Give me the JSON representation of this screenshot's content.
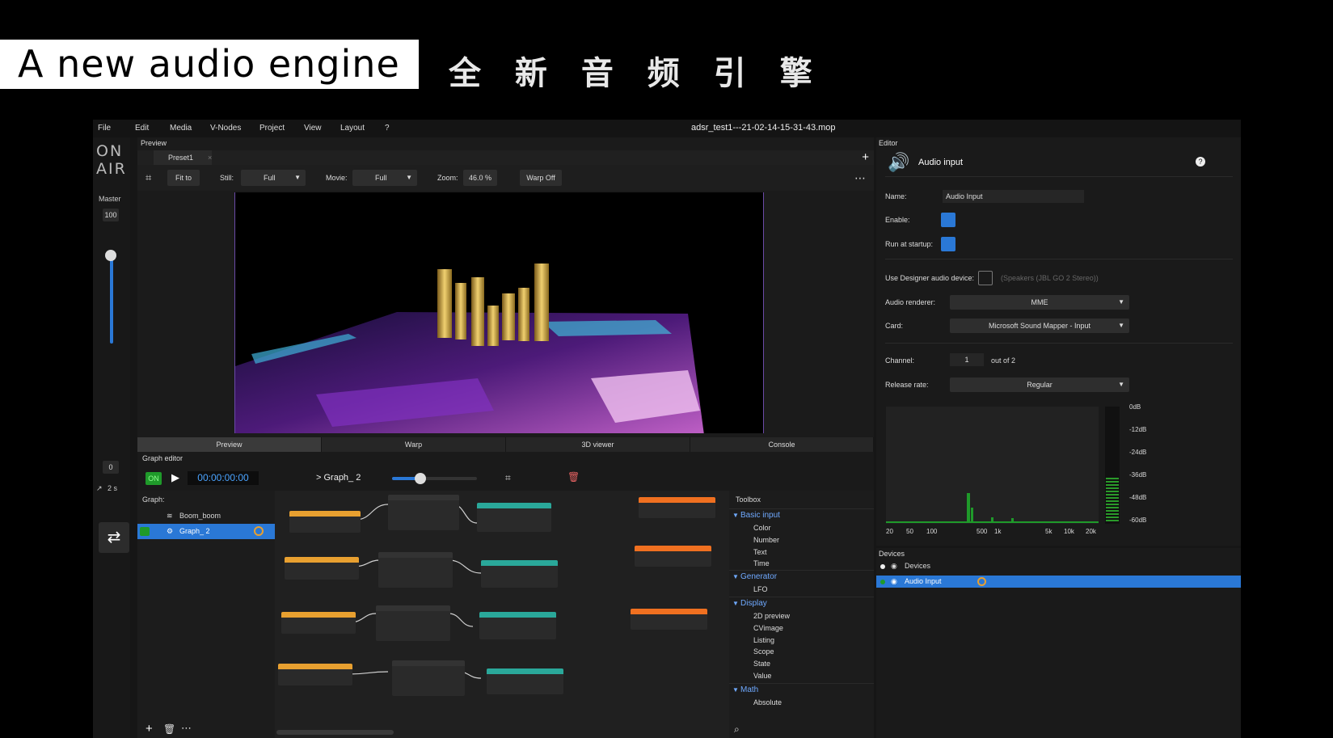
{
  "banner": {
    "title": "A new audio engine",
    "subtitle_cn": "全 新 音 频 引 擎"
  },
  "menubar": {
    "items": [
      "File",
      "Edit",
      "Media",
      "V-Nodes",
      "Project",
      "View",
      "Layout",
      "?"
    ],
    "file_title": "adsr_test1---21-02-14-15-31-43.mop"
  },
  "left_rail": {
    "logo_line1": "ON",
    "logo_line2": "AIR",
    "master_label": "Master",
    "master_value": "100",
    "zero_value": "0",
    "time_value": "2 s"
  },
  "preview": {
    "panel_title": "Preview",
    "tab": "Preset1",
    "fit_label": "Fit to",
    "still_label": "Still:",
    "still_value": "Full",
    "movie_label": "Movie:",
    "movie_value": "Full",
    "zoom_label": "Zoom:",
    "zoom_value": "46.0",
    "zoom_unit": "%",
    "warp_label": "Warp Off"
  },
  "bottom_tabs": [
    "Preview",
    "Warp",
    "3D viewer",
    "Console"
  ],
  "graph_editor": {
    "title": "Graph editor",
    "on_label": "ON",
    "timecode": "00:00:00:00",
    "graph_path": "> Graph_ 2",
    "graph_label": "Graph:",
    "graphs": [
      "Boom_boom",
      "Graph_ 2"
    ]
  },
  "toolbox": {
    "title": "Toolbox",
    "categories": [
      {
        "name": "Basic input",
        "items": [
          "Color",
          "Number",
          "Text",
          "Time"
        ]
      },
      {
        "name": "Generator",
        "items": [
          "LFO"
        ]
      },
      {
        "name": "Display",
        "items": [
          "2D preview",
          "CVimage",
          "Listing",
          "Scope",
          "State",
          "Value"
        ]
      },
      {
        "name": "Math",
        "items": [
          "Absolute"
        ]
      }
    ]
  },
  "editor": {
    "panel_title": "Editor",
    "heading": "Audio input",
    "name_label": "Name:",
    "name_value": "Audio Input",
    "enable_label": "Enable:",
    "run_label": "Run at startup:",
    "designer_label": "Use Designer audio device:",
    "designer_hint": "(Speakers (JBL GO 2 Stereo))",
    "renderer_label": "Audio renderer:",
    "renderer_value": "MME",
    "card_label": "Card:",
    "card_value": "Microsoft Sound Mapper - Input",
    "channel_label": "Channel:",
    "channel_value": "1",
    "channel_suffix": "out of 2",
    "release_label": "Release rate:",
    "release_value": "Regular",
    "db_ticks": [
      "0dB",
      "-12dB",
      "-24dB",
      "-36dB",
      "-48dB",
      "-60dB"
    ],
    "freq_ticks": [
      "20",
      "50",
      "100",
      "500",
      "1k",
      "5k",
      "10k",
      "20k"
    ]
  },
  "devices": {
    "panel_title": "Devices",
    "items": [
      "Devices",
      "Audio Input"
    ]
  },
  "colors": {
    "accent": "#2a78d6",
    "on_green": "#1f9a2a",
    "timecode_blue": "#4aa3ff"
  }
}
